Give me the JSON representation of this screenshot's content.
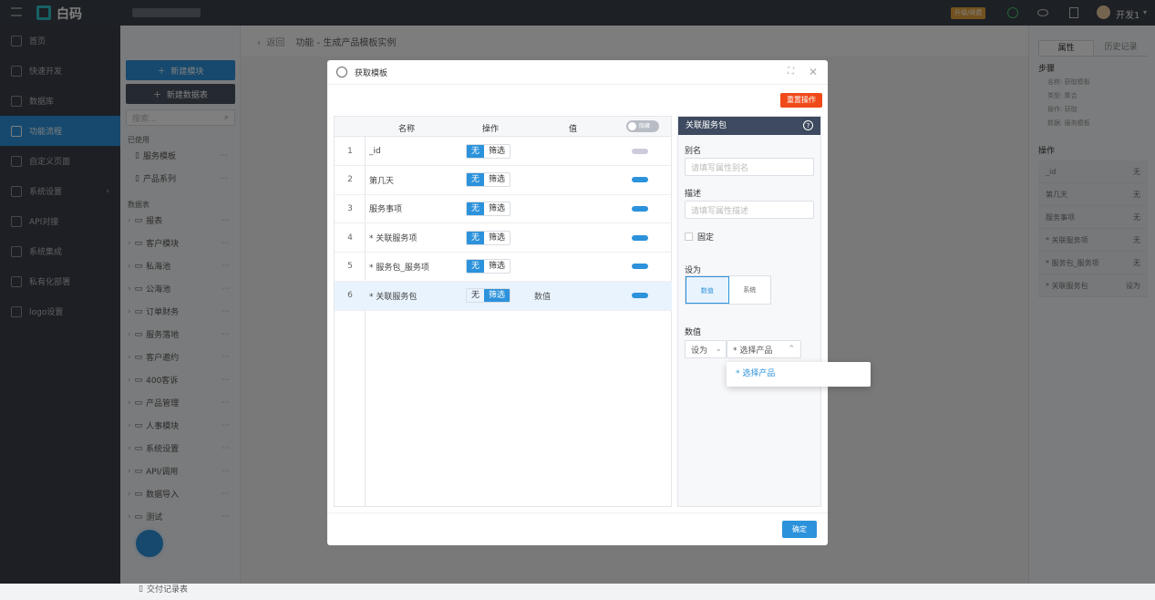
{
  "topbar": {
    "logo": "白码",
    "upgrade_badge": "升级/续费",
    "user": "开发1"
  },
  "sidebar": {
    "items": [
      {
        "label": "首页"
      },
      {
        "label": "快速开发"
      },
      {
        "label": "数据库"
      },
      {
        "label": "功能流程"
      },
      {
        "label": "自定义页面"
      },
      {
        "label": "系统设置"
      },
      {
        "label": "API对接"
      },
      {
        "label": "系统集成"
      },
      {
        "label": "私有化部署"
      },
      {
        "label": "logo设置"
      }
    ]
  },
  "tree": {
    "new_module": "新建模块",
    "new_table": "新建数据表",
    "search_placeholder": "搜索...",
    "used_title": "已使用",
    "used": [
      "服务模板",
      "产品系列"
    ],
    "tables_title": "数据表",
    "tables": [
      "报表",
      "客户模块",
      "私海池",
      "公海池",
      "订单财务",
      "服务落地",
      "客户邀约",
      "400客诉",
      "产品管理",
      "人事模块",
      "系统设置",
      "API/调用",
      "数据导入",
      "测试"
    ],
    "bottom_item": "交付记录表"
  },
  "breadcrumb": {
    "back": "返回",
    "title": "功能 - 生成产品模板实例"
  },
  "right_panel": {
    "tabs": [
      "属性",
      "历史记录"
    ],
    "steps_title": "步骤",
    "steps": [
      "名称: 获取模板",
      "类型: 集合",
      "操作: 获取",
      "数据: 服务模板"
    ],
    "ops_title": "操作",
    "ops": [
      {
        "name": "_id",
        "value": "无"
      },
      {
        "name": "第几天",
        "value": "无"
      },
      {
        "name": "服务事项",
        "value": "无"
      },
      {
        "name": "* 关联服务项",
        "value": "无"
      },
      {
        "name": "* 服务包_服务项",
        "value": "无"
      },
      {
        "name": "* 关联服务包",
        "value": "设为"
      }
    ]
  },
  "modal": {
    "title": "获取模板",
    "reset_button": "重置操作",
    "confirm_button": "确定",
    "table": {
      "headers": [
        "名称",
        "操作",
        "值"
      ],
      "header_toggle": "隐藏",
      "rows": [
        {
          "num": "1",
          "name": "_id",
          "seg_a": "无",
          "seg_b": "筛选",
          "active": "a",
          "value": "",
          "toggle": "off"
        },
        {
          "num": "2",
          "name": "第几天",
          "seg_a": "无",
          "seg_b": "筛选",
          "active": "a",
          "value": "",
          "toggle": "on"
        },
        {
          "num": "3",
          "name": "服务事项",
          "seg_a": "无",
          "seg_b": "筛选",
          "active": "a",
          "value": "",
          "toggle": "on"
        },
        {
          "num": "4",
          "name": "* 关联服务项",
          "seg_a": "无",
          "seg_b": "筛选",
          "active": "a",
          "value": "",
          "toggle": "on"
        },
        {
          "num": "5",
          "name": "* 服务包_服务项",
          "seg_a": "无",
          "seg_b": "筛选",
          "active": "a",
          "value": "",
          "toggle": "on"
        },
        {
          "num": "6",
          "name": "* 关联服务包",
          "seg_a": "无",
          "seg_b": "筛选",
          "active": "b",
          "value": "数值",
          "toggle": "on"
        }
      ]
    },
    "props": {
      "title": "关联服务包",
      "alias_label": "别名",
      "alias_placeholder": "请填写属性别名",
      "desc_label": "描述",
      "desc_placeholder": "请填写属性描述",
      "fixed_label": "固定",
      "set_label": "设为",
      "set_options": [
        "数值",
        "系统"
      ],
      "value_label": "数值",
      "value_op": "设为",
      "value_select": "* 选择产品",
      "dropdown_option": "* 选择产品"
    }
  }
}
